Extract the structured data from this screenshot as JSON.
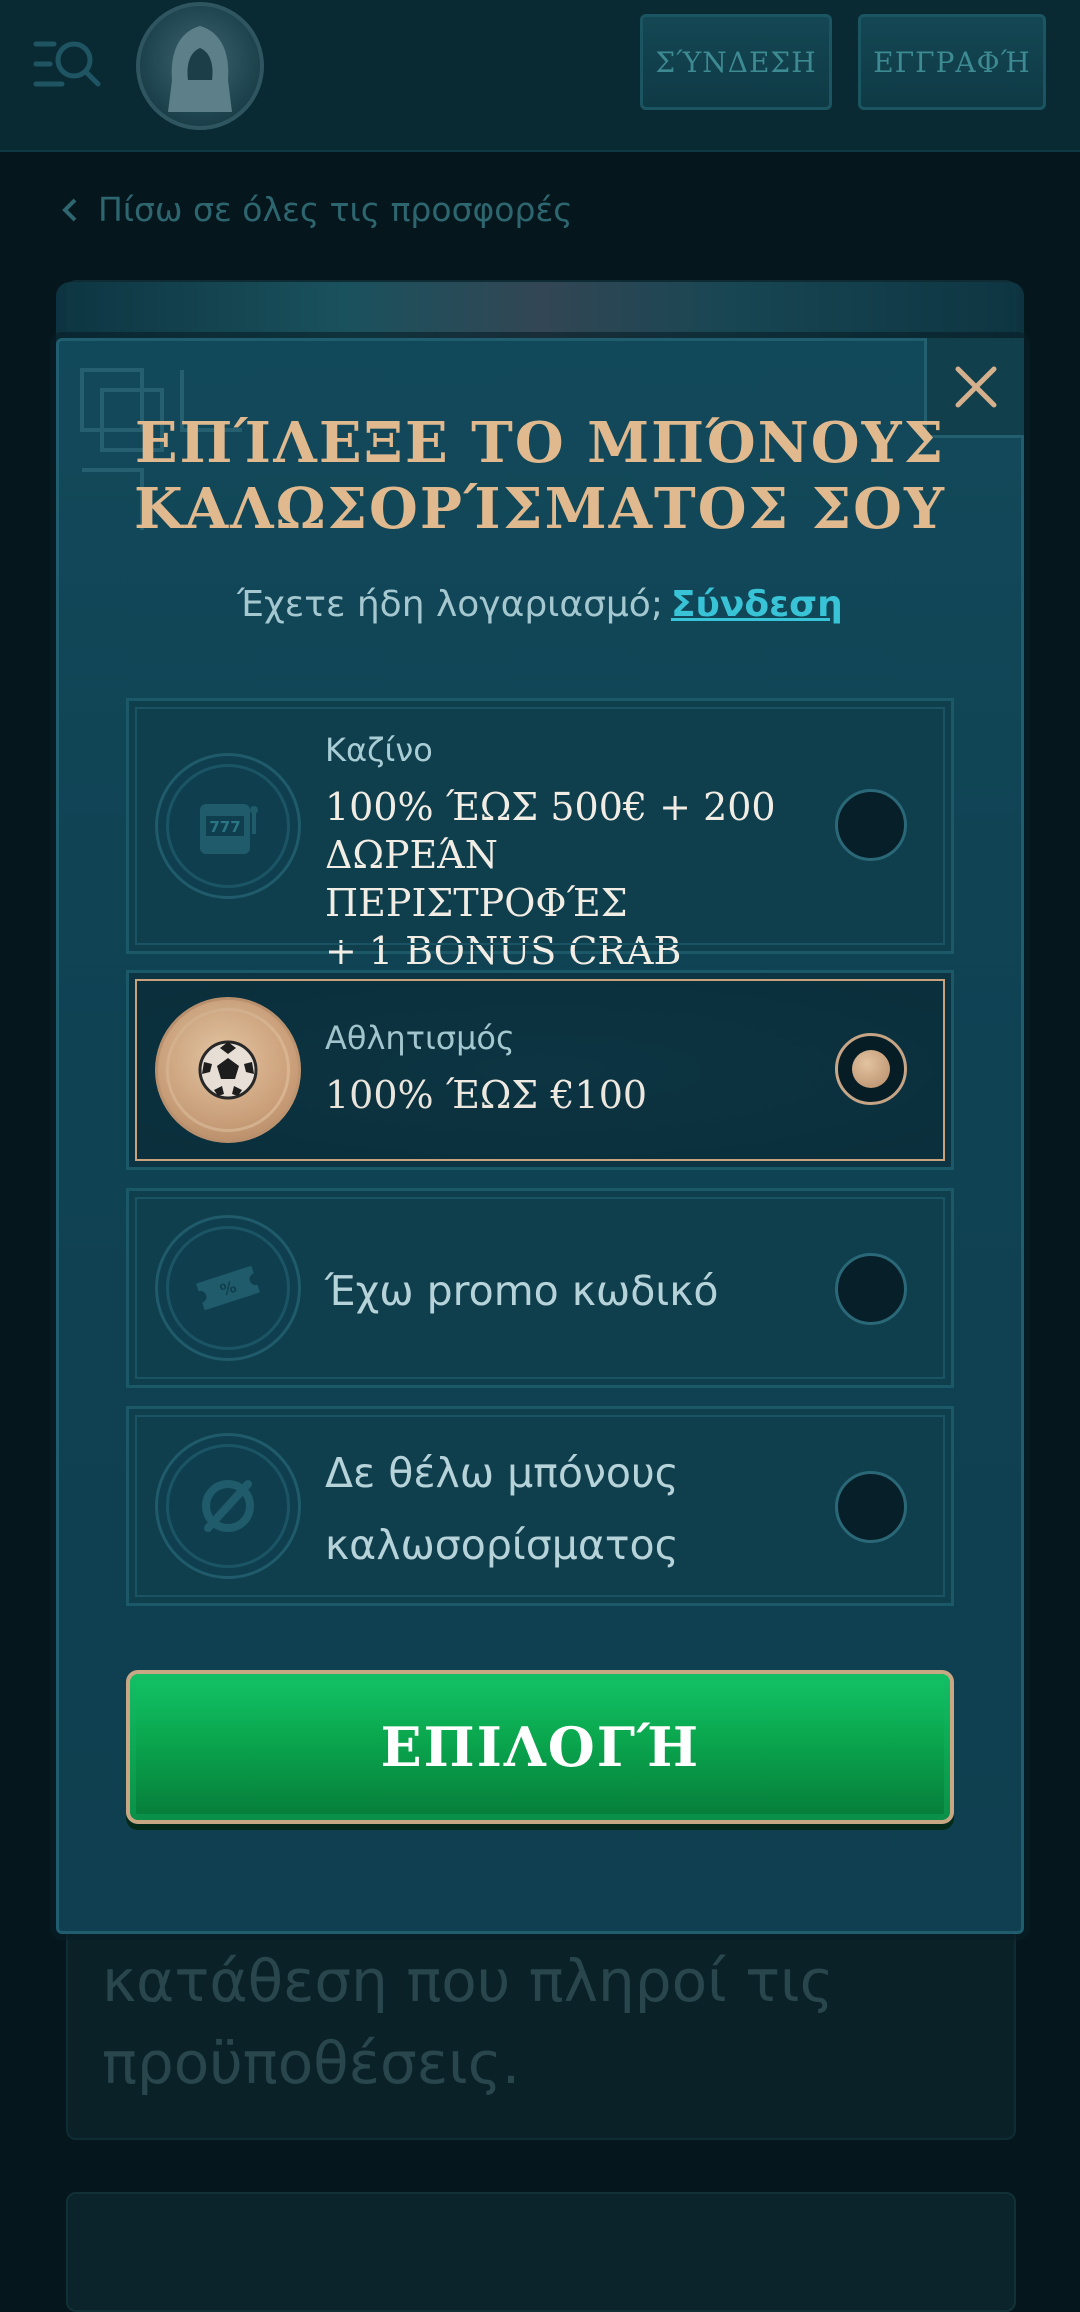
{
  "header": {
    "login_label": "ΣΎΝΔΕΣΗ",
    "register_label": "ΕΓΓΡΑΦΉ"
  },
  "back_link": "Πίσω σε όλες τις προσφορές",
  "background_text": "κατάθεση που πληροί τις προϋποθέσεις.",
  "modal": {
    "title_line1": "ΕΠΊΛΕΞΕ ΤΟ ΜΠΌΝΟΥΣ",
    "title_line2": "ΚΑΛΩΣΟΡΊΣΜΑΤΟΣ ΣΟΥ",
    "login_prompt": "Έχετε ήδη λογαριασμό;",
    "login_link": "Σύνδεση",
    "options": [
      {
        "category": "Καζίνο",
        "line1": "100% ΈΩΣ 500€ + 200",
        "line2": "ΔΩΡΕΆΝ ΠΕΡΙΣΤΡΟΦΈΣ",
        "line3": "+ 1 BONUS CRAB",
        "selected": false,
        "icon": "slot-machine-icon"
      },
      {
        "category": "Αθλητισμός",
        "line1": "100% ΈΩΣ €100",
        "selected": true,
        "icon": "soccer-ball-icon"
      },
      {
        "label": "Έχω promo κωδικό",
        "selected": false,
        "icon": "ticket-icon"
      },
      {
        "line1": "Δε θέλω μπόνους",
        "line2": "καλωσορίσματος",
        "selected": false,
        "icon": "no-symbol-icon"
      }
    ],
    "submit_label": "ΕΠΙΛΟΓΉ"
  },
  "colors": {
    "title_gold": "#e0b98f",
    "link_cyan": "#38c4d6",
    "button_green": "#0aa64e",
    "modal_bg": "#0f4253"
  }
}
